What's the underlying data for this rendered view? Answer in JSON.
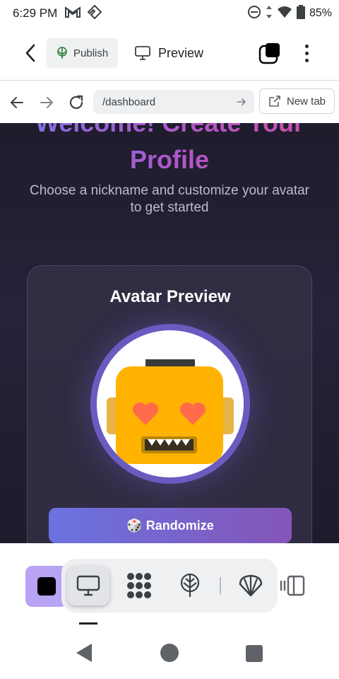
{
  "status_bar": {
    "time": "6:29 PM",
    "battery": "85%",
    "left_icons": [
      "gmail-icon",
      "app-notification-icon"
    ],
    "right_icons": [
      "do-not-disturb-icon",
      "data-arrows-icon",
      "wifi-icon",
      "battery-icon"
    ]
  },
  "toolbar": {
    "publish_label": "Publish",
    "preview_label": "Preview"
  },
  "browser": {
    "url": "/dashboard",
    "new_tab_label": "New tab"
  },
  "page": {
    "title": "Welcome! Create Your Profile",
    "subtitle": "Choose a nickname and customize your avatar to get started",
    "card_title": "Avatar Preview",
    "randomize_label": "🎲 Randomize"
  },
  "colors": {
    "accent_purple": "#b8a3f5",
    "avatar_face": "#ffb300",
    "avatar_eyes": "#ff6b4a",
    "ring": "#6a5bc0",
    "button_gradient_start": "#6a72e0",
    "button_gradient_end": "#8556b8"
  },
  "bottom_toolbar": {
    "tools": [
      "desktop-preview-icon",
      "pattern-icon",
      "publish-tree-icon",
      "shell-icon"
    ],
    "active_tool": "desktop-preview-icon"
  }
}
